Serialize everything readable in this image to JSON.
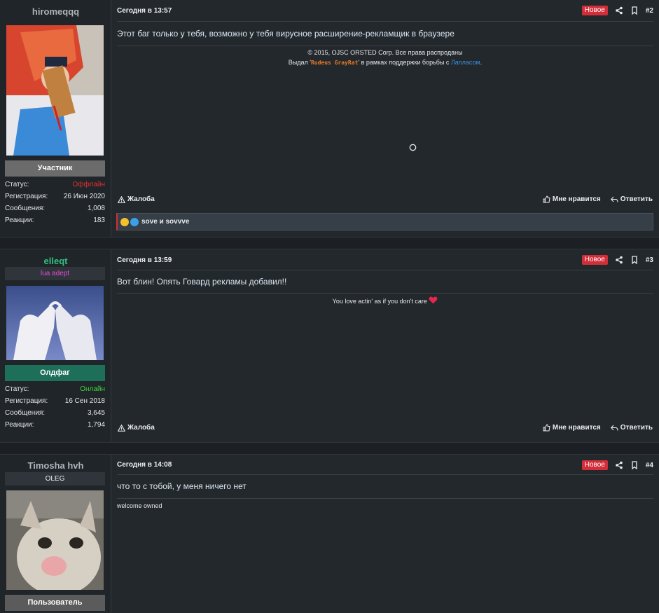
{
  "posts": [
    {
      "username": "hiromeqqq",
      "user_title": "",
      "rank": "Участник",
      "rank_color": "#6b6b6b",
      "stats": [
        {
          "label": "Статус:",
          "value": "Оффлайн",
          "color": "#e0302f"
        },
        {
          "label": "Регистрация:",
          "value": "26 Июн 2020"
        },
        {
          "label": "Сообщения:",
          "value": "1,008"
        },
        {
          "label": "Реакции:",
          "value": "183"
        }
      ],
      "date": "Сегодня в 13:57",
      "badge": "Новое",
      "number": "#2",
      "message": "Этот баг только у тебя, возможно у тебя вирусное расширение-рекламщик в браузере",
      "signature": {
        "line1": "© 2015, OJSC ORSTED Corp. Все права распроданы",
        "line2_prefix": "Выдал '",
        "line2_name": "Rudeus GrayRat",
        "line2_mid": "' в рамках поддержки борьбы с ",
        "line2_link": "Лапласом",
        "line2_suffix": "."
      },
      "report": "Жалоба",
      "like": "Мне нравится",
      "reply": "Ответить",
      "reactions_text": "sove и sovvve"
    },
    {
      "username": "elleqt",
      "user_title": "lua adept",
      "rank": "Олдфаг",
      "rank_color": "#1d6f5a",
      "stats": [
        {
          "label": "Статус:",
          "value": "Онлайн",
          "color": "#3fd13c"
        },
        {
          "label": "Регистрация:",
          "value": "16 Сен 2018"
        },
        {
          "label": "Сообщения:",
          "value": "3,645"
        },
        {
          "label": "Реакции:",
          "value": "1,794"
        }
      ],
      "date": "Сегодня в 13:59",
      "badge": "Новое",
      "number": "#3",
      "message": "Вот блин! Опять Говард рекламы добавил!!",
      "signature_text": "You love actin' as if you don't care",
      "report": "Жалоба",
      "like": "Мне нравится",
      "reply": "Ответить"
    },
    {
      "username": "Timosha hvh",
      "user_title": "OLEG",
      "rank": "Пользователь",
      "rank_color": "#5b5b5b",
      "date": "Сегодня в 14:08",
      "badge": "Новое",
      "number": "#4",
      "message": "что то с тобой, у меня ничего нет",
      "signature_text": "welcome owned"
    }
  ],
  "colors": {
    "username_green": "#2ec27e",
    "user_title_pink": "#e84ad8",
    "link_blue": "#3a8fe0",
    "sig_orange": "#e87a2a",
    "badge_red": "#d12e3a"
  }
}
